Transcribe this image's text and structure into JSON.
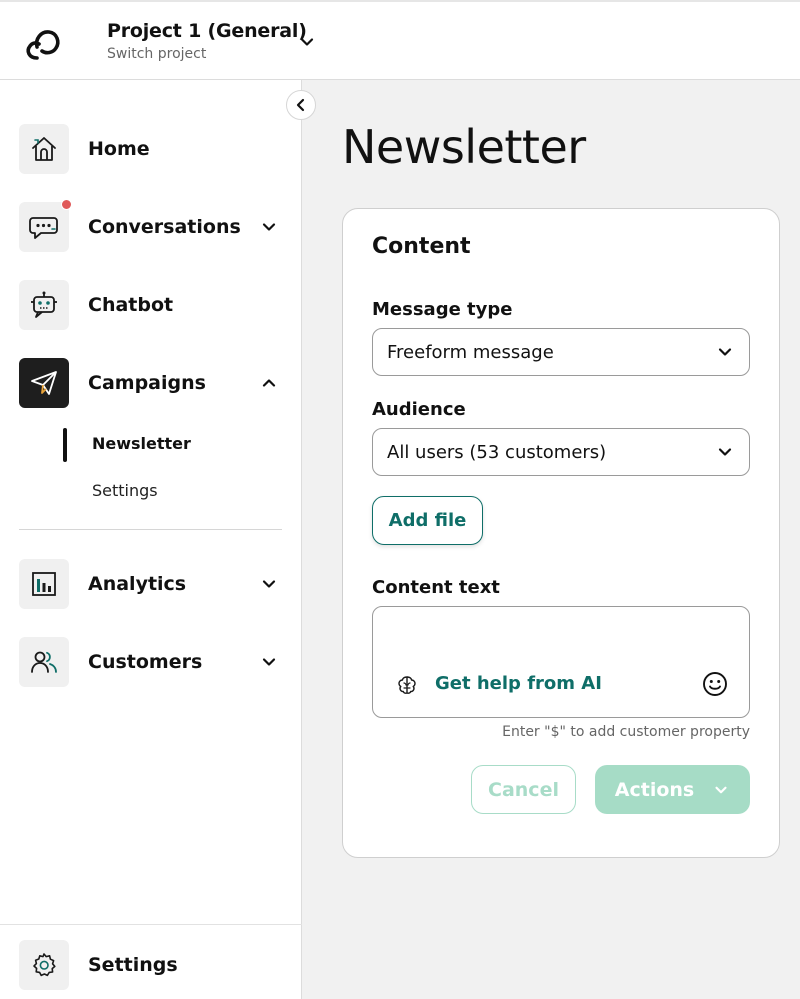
{
  "header": {
    "project_title": "Project 1 (General)",
    "project_subtitle": "Switch project",
    "logo_icon": "cloud-logo-icon",
    "switch_icon": "chevron-down-icon"
  },
  "sidebar": {
    "collapse_icon": "chevron-left-icon",
    "items": [
      {
        "label": "Home",
        "icon": "home-icon",
        "has_chevron": false
      },
      {
        "label": "Conversations",
        "icon": "chat-bubble-icon",
        "has_chevron": true,
        "expanded": false,
        "notification": true
      },
      {
        "label": "Chatbot",
        "icon": "robot-icon",
        "has_chevron": false
      },
      {
        "label": "Campaigns",
        "icon": "paper-plane-icon",
        "has_chevron": true,
        "expanded": true,
        "active": true
      },
      {
        "label": "Analytics",
        "icon": "bar-chart-icon",
        "has_chevron": true,
        "expanded": false
      },
      {
        "label": "Customers",
        "icon": "users-icon",
        "has_chevron": true,
        "expanded": false
      }
    ],
    "sub_items": [
      {
        "label": "Newsletter",
        "active": true
      },
      {
        "label": "Settings",
        "active": false
      }
    ],
    "footer_item": {
      "label": "Settings",
      "icon": "gear-icon"
    }
  },
  "main": {
    "page_title": "Newsletter",
    "card": {
      "title": "Content",
      "message_type": {
        "label": "Message type",
        "value": "Freeform message"
      },
      "audience": {
        "label": "Audience",
        "value": "All users (53 customers)"
      },
      "add_file_label": "Add file",
      "content_text": {
        "label": "Content text",
        "value": "",
        "ai_help_label": "Get help from AI",
        "hint": "Enter \"$\" to add customer property"
      },
      "cancel_label": "Cancel",
      "actions_label": "Actions"
    }
  },
  "colors": {
    "accent": "#0f6e68",
    "accent_light": "#a6dcc6",
    "notification": "#e05a5a",
    "active_nav_bg": "#1e1e1e",
    "main_bg": "#f1f1f1"
  }
}
